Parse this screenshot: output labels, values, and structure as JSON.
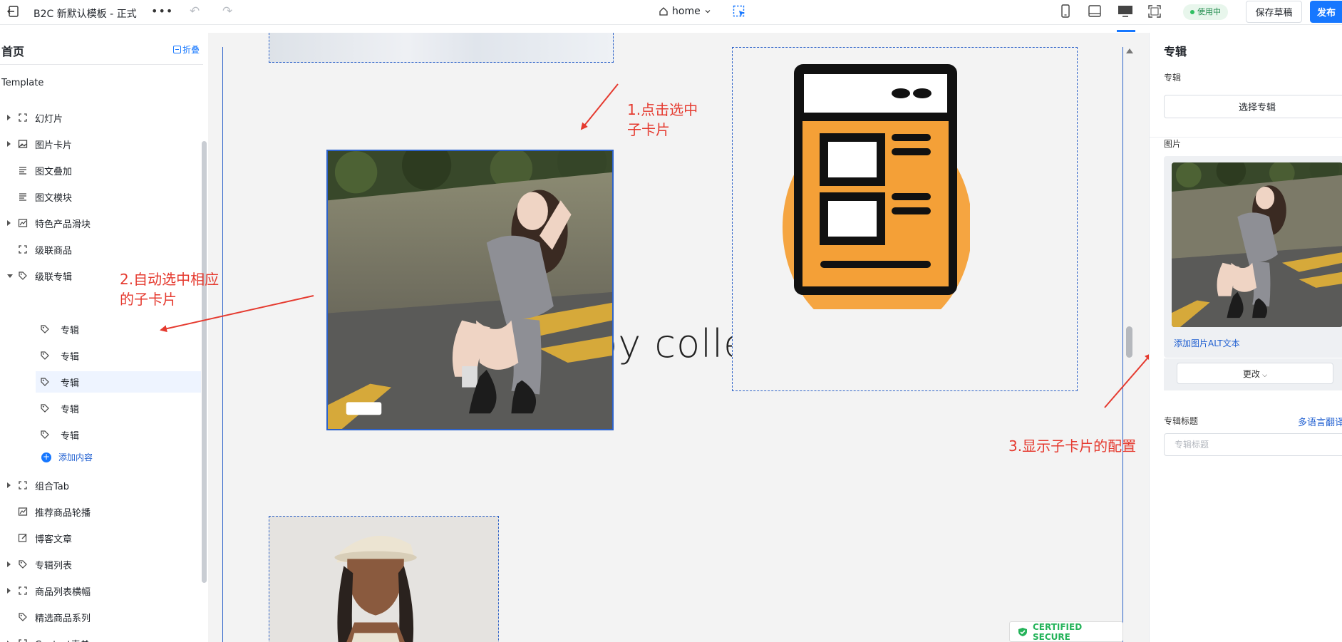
{
  "topbar": {
    "title": "B2C 新默认模板 - 正式",
    "more": "•••",
    "page": "home",
    "status": "使用中",
    "save_label": "保存草稿",
    "publish_label": "发布"
  },
  "left": {
    "header": "首页",
    "collapse_label": "折叠",
    "section": "Template",
    "items": [
      {
        "label": "幻灯片",
        "icon": "slideshow-icon",
        "caret": true
      },
      {
        "label": "图片卡片",
        "icon": "image-card-icon",
        "caret": true
      },
      {
        "label": "图文叠加",
        "icon": "text-overlay-icon",
        "caret": false
      },
      {
        "label": "图文模块",
        "icon": "text-module-icon",
        "caret": false
      },
      {
        "label": "特色产品滑块",
        "icon": "chart-icon",
        "caret": true
      },
      {
        "label": "级联商品",
        "icon": "frame-icon",
        "caret": false
      },
      {
        "label": "级联专辑",
        "icon": "tag-icon",
        "caret": true,
        "open": true
      }
    ],
    "children": [
      "专辑",
      "专辑",
      "专辑",
      "专辑",
      "专辑"
    ],
    "add_content": "添加内容",
    "items_after": [
      {
        "label": "组合Tab",
        "icon": "frame-icon",
        "caret": true
      },
      {
        "label": "推荐商品轮播",
        "icon": "chart-icon",
        "caret": false
      },
      {
        "label": "博客文章",
        "icon": "edit-icon",
        "caret": false
      },
      {
        "label": "专辑列表",
        "icon": "tag-icon",
        "caret": true
      },
      {
        "label": "商品列表横幅",
        "icon": "frame-icon",
        "caret": true
      },
      {
        "label": "精选商品系列",
        "icon": "tag-icon",
        "caret": false
      },
      {
        "label": "Contact表单",
        "icon": "frame-icon",
        "caret": true
      }
    ]
  },
  "canvas": {
    "big_text": "by colle",
    "badge": "CERTIFIED SECURE"
  },
  "annotations": {
    "note1": [
      "1.点击选中",
      "子卡片"
    ],
    "note2": [
      "2.自动选中相应",
      "的子卡片"
    ],
    "note3": "3.显示子卡片的配置"
  },
  "right": {
    "title": "专辑",
    "album_label": "专辑",
    "choose_album": "选择专辑",
    "image_label": "图片",
    "alt_link": "添加图片ALT文本",
    "change_label": "更改",
    "album_title_label": "专辑标题",
    "translate": "多语言翻译",
    "title_placeholder": "专辑标题"
  },
  "colors": {
    "accent": "#1677ff",
    "selection": "#2d62c9",
    "annotation": "#e53a2f",
    "status_green": "#1f8b4c"
  }
}
